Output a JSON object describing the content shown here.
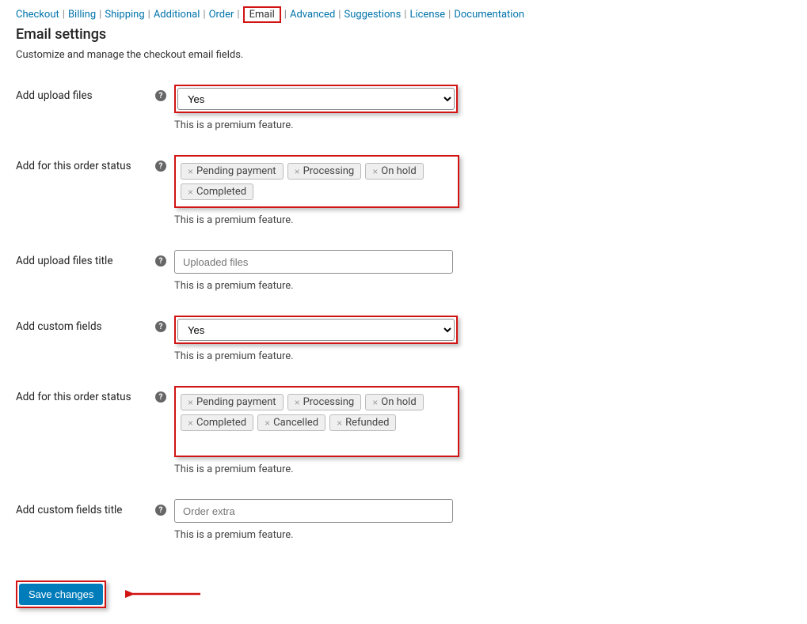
{
  "tabs": {
    "items": [
      "Checkout",
      "Billing",
      "Shipping",
      "Additional",
      "Order",
      "Email",
      "Advanced",
      "Suggestions",
      "License",
      "Documentation"
    ],
    "activeIndex": 5
  },
  "page": {
    "title": "Email settings",
    "subtitle": "Customize and manage the checkout email fields."
  },
  "premium_note": "This is a premium feature.",
  "fields": {
    "upload_files": {
      "label": "Add upload files",
      "value": "Yes"
    },
    "upload_status": {
      "label": "Add for this order status",
      "tags": [
        "Pending payment",
        "Processing",
        "On hold",
        "Completed"
      ]
    },
    "upload_title": {
      "label": "Add upload files title",
      "placeholder": "Uploaded files"
    },
    "custom_fields": {
      "label": "Add custom fields",
      "value": "Yes"
    },
    "custom_status": {
      "label": "Add for this order status",
      "tags": [
        "Pending payment",
        "Processing",
        "On hold",
        "Completed",
        "Cancelled",
        "Refunded"
      ]
    },
    "custom_title": {
      "label": "Add custom fields title",
      "placeholder": "Order extra"
    }
  },
  "buttons": {
    "save": "Save changes"
  },
  "highlight_color": "#d11313",
  "accent_color": "#007cba"
}
